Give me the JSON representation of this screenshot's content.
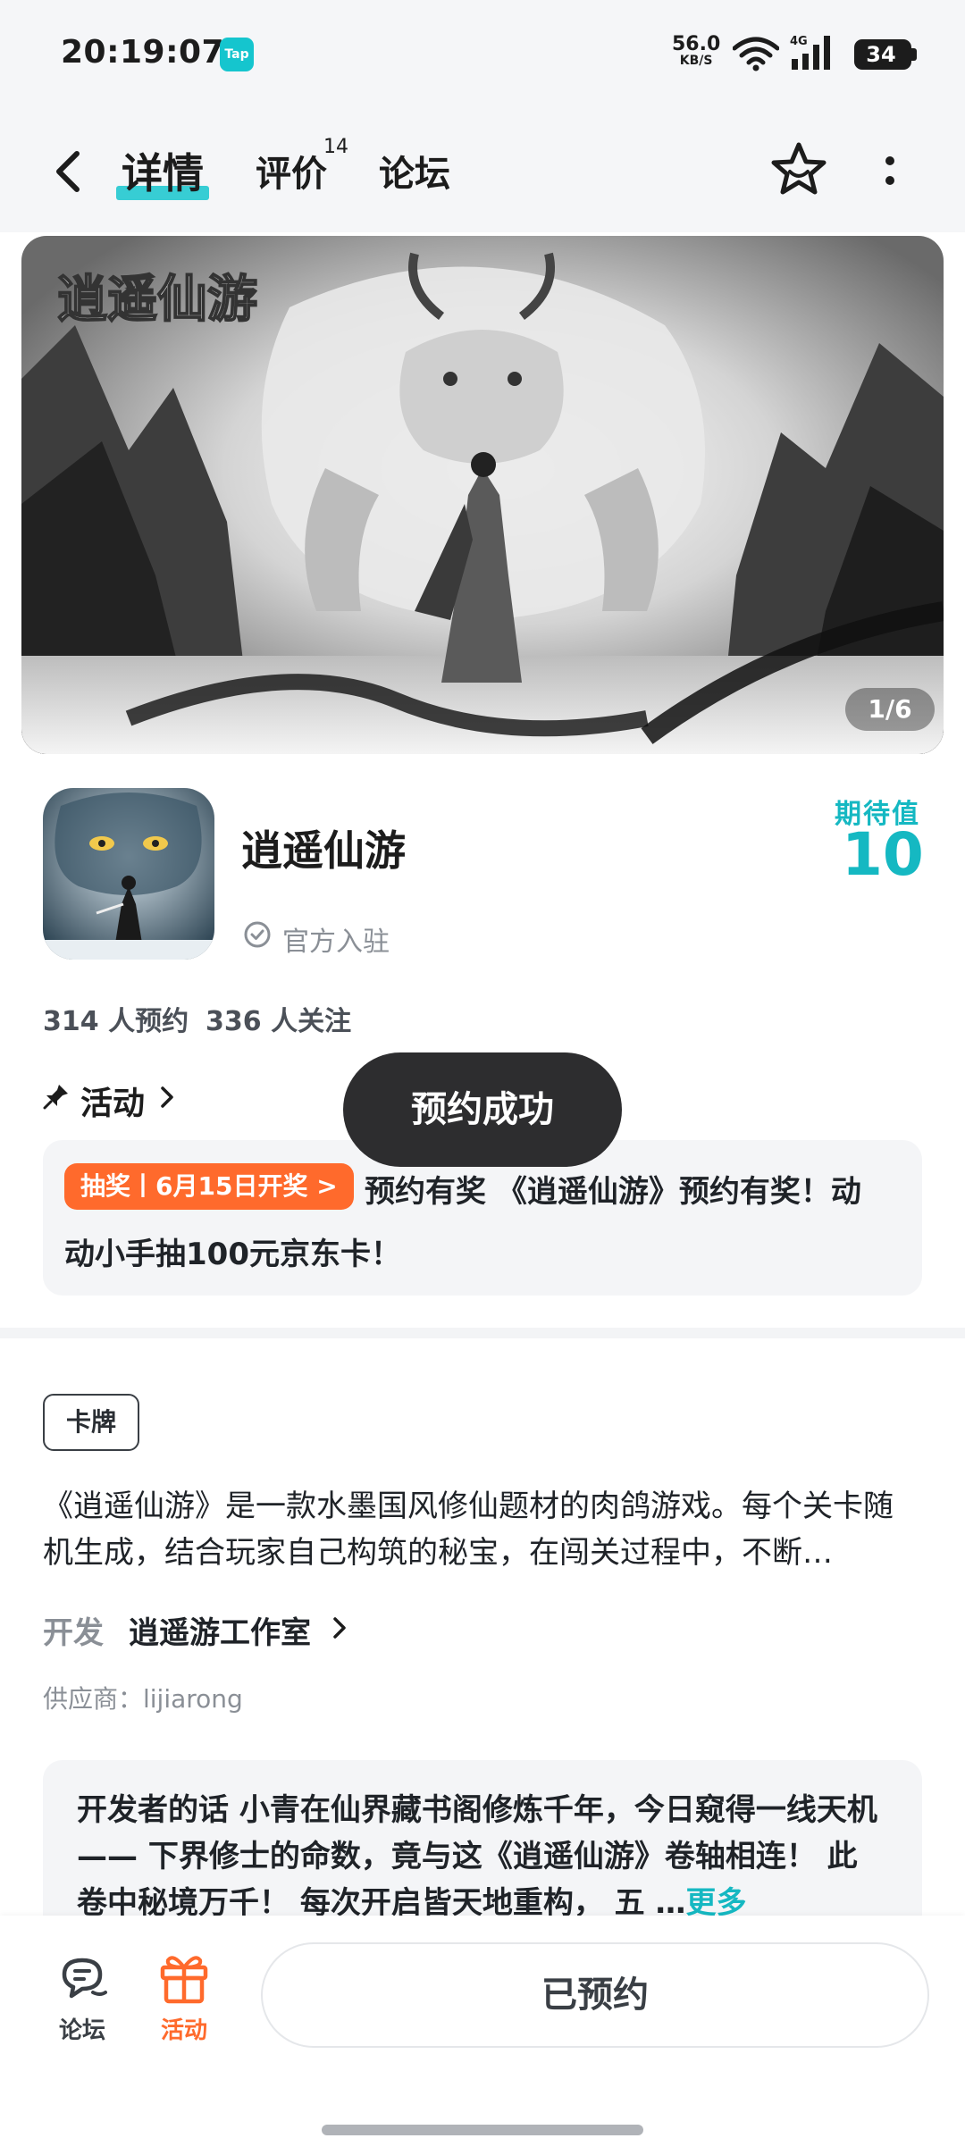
{
  "status_bar": {
    "time": "20:19:07",
    "app_badge": "Tap",
    "net_speed": "56.0",
    "net_unit": "KB/S",
    "network_type": "4G",
    "battery": "34"
  },
  "nav": {
    "tabs": [
      {
        "label": "详情",
        "active": true
      },
      {
        "label": "评价",
        "count": "14"
      },
      {
        "label": "论坛"
      }
    ],
    "accent_color": "#15c5ce"
  },
  "banner": {
    "logo_text": "逍遥仙游",
    "counter": "1/6"
  },
  "game": {
    "title": "逍遥仙游",
    "official_label": "官方入驻",
    "expect_label": "期待值",
    "expect_value": "10",
    "reservations": "314 人预约",
    "followers": "336 人关注"
  },
  "activity": {
    "section_label": "活动",
    "tag": "抽奖丨6月15日开奖 >",
    "line1": "预约有奖 《逍遥仙游》预约有奖！动",
    "line2": "动小手抽100元京东卡！"
  },
  "toast": {
    "text": "预约成功"
  },
  "description": {
    "tag": "卡牌",
    "text": "《逍遥仙游》是一款水墨国风修仙题材的肉鸽游戏。每个关卡随机生成，结合玩家自己构筑的秘宝，在闯关过程中，不断…",
    "developer_label": "开发",
    "developer_name": "逍遥游工作室",
    "supplier": "供应商：lijiarong"
  },
  "developer_note": {
    "title": "开发者的话",
    "text": "小青在仙界藏书阁修炼千年，今日窥得一线天机 —— 下界修士的命数，竟与这《逍遥仙游》卷轴相连！ 此卷中秘境万千！ 每次开启皆天地重构， 五 …",
    "more": "更多"
  },
  "bottom_bar": {
    "forum_label": "论坛",
    "activity_label": "活动",
    "reserve_button": "已预约",
    "activity_color": "#ff6a2c"
  }
}
